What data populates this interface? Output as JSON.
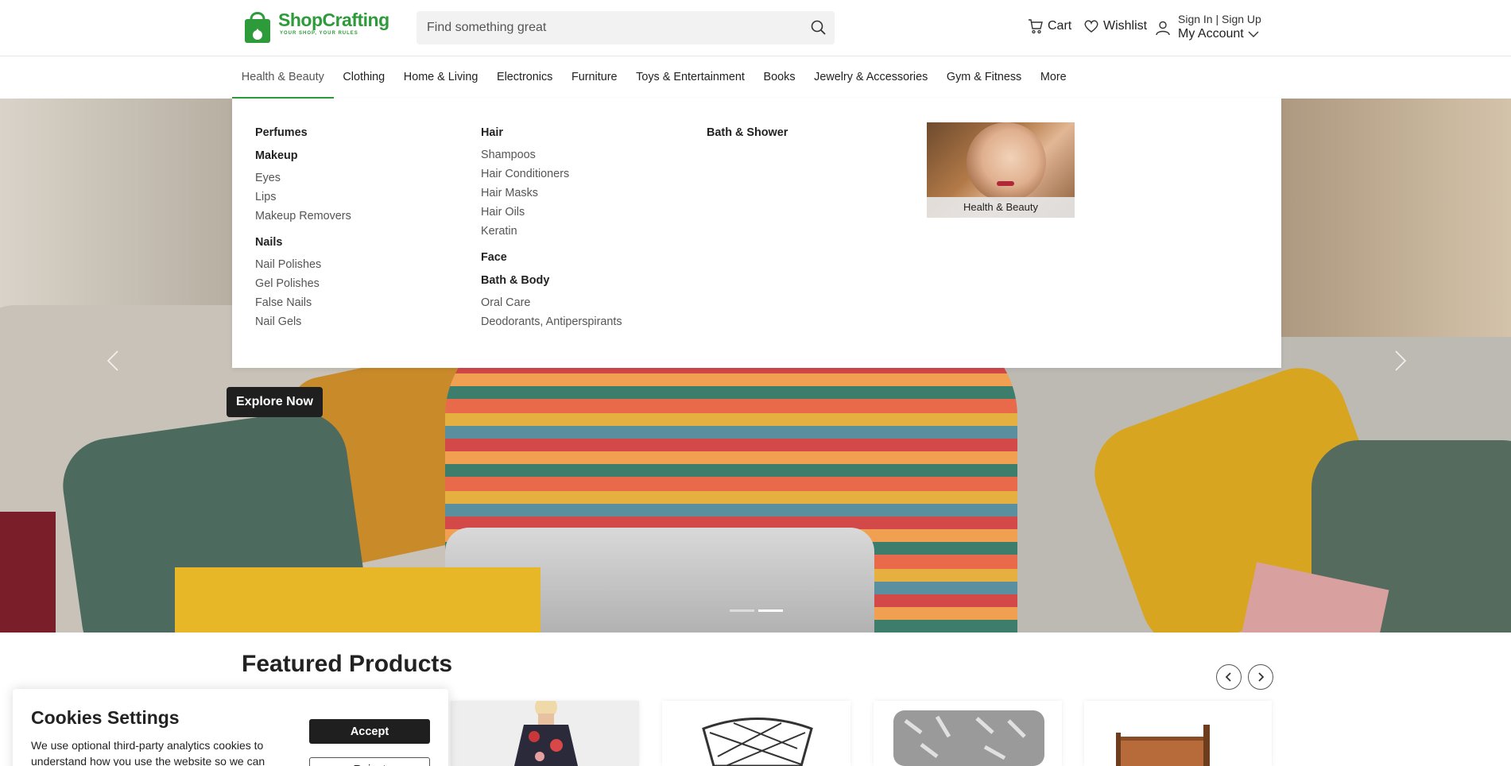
{
  "brand": {
    "name": "ShopCrafting",
    "tagline": "YOUR SHOP, YOUR RULES",
    "accent_color": "#2e9b3a"
  },
  "search": {
    "placeholder": "Find something great",
    "icon": "search-icon"
  },
  "header": {
    "cart_label": "Cart",
    "wishlist_label": "Wishlist",
    "sign_in_label": "Sign In | Sign Up",
    "account_label": "My Account"
  },
  "nav": {
    "items": [
      {
        "label": "Health & Beauty",
        "active": true
      },
      {
        "label": "Clothing"
      },
      {
        "label": "Home & Living"
      },
      {
        "label": "Electronics"
      },
      {
        "label": "Furniture"
      },
      {
        "label": "Toys & Entertainment"
      },
      {
        "label": "Books"
      },
      {
        "label": "Jewelry & Accessories"
      },
      {
        "label": "Gym & Fitness"
      },
      {
        "label": "More"
      }
    ]
  },
  "mega_menu": {
    "col1": {
      "perfumes": "Perfumes",
      "makeup": "Makeup",
      "makeup_items": [
        "Eyes",
        "Lips",
        "Makeup Removers"
      ],
      "nails": "Nails",
      "nails_items": [
        "Nail Polishes",
        "Gel Polishes",
        "False Nails",
        "Nail Gels"
      ]
    },
    "col2": {
      "hair": "Hair",
      "hair_items": [
        "Shampoos",
        "Hair Conditioners",
        "Hair Masks",
        "Hair Oils",
        "Keratin"
      ],
      "face": "Face",
      "bath_body": "Bath & Body",
      "bath_body_items": [
        "Oral Care",
        "Deodorants, Antiperspirants"
      ]
    },
    "col3": {
      "bath_shower": "Bath & Shower"
    },
    "promo_label": "Health & Beauty"
  },
  "hero": {
    "button_label": "Explore Now",
    "slide_count": 2,
    "active_slide": 2
  },
  "featured": {
    "title": "Featured Products"
  },
  "cookies": {
    "title": "Cookies Settings",
    "text": "We use optional third-party analytics cookies to understand how you use the website so we can",
    "accept_label": "Accept",
    "reject_label": "Reject"
  }
}
